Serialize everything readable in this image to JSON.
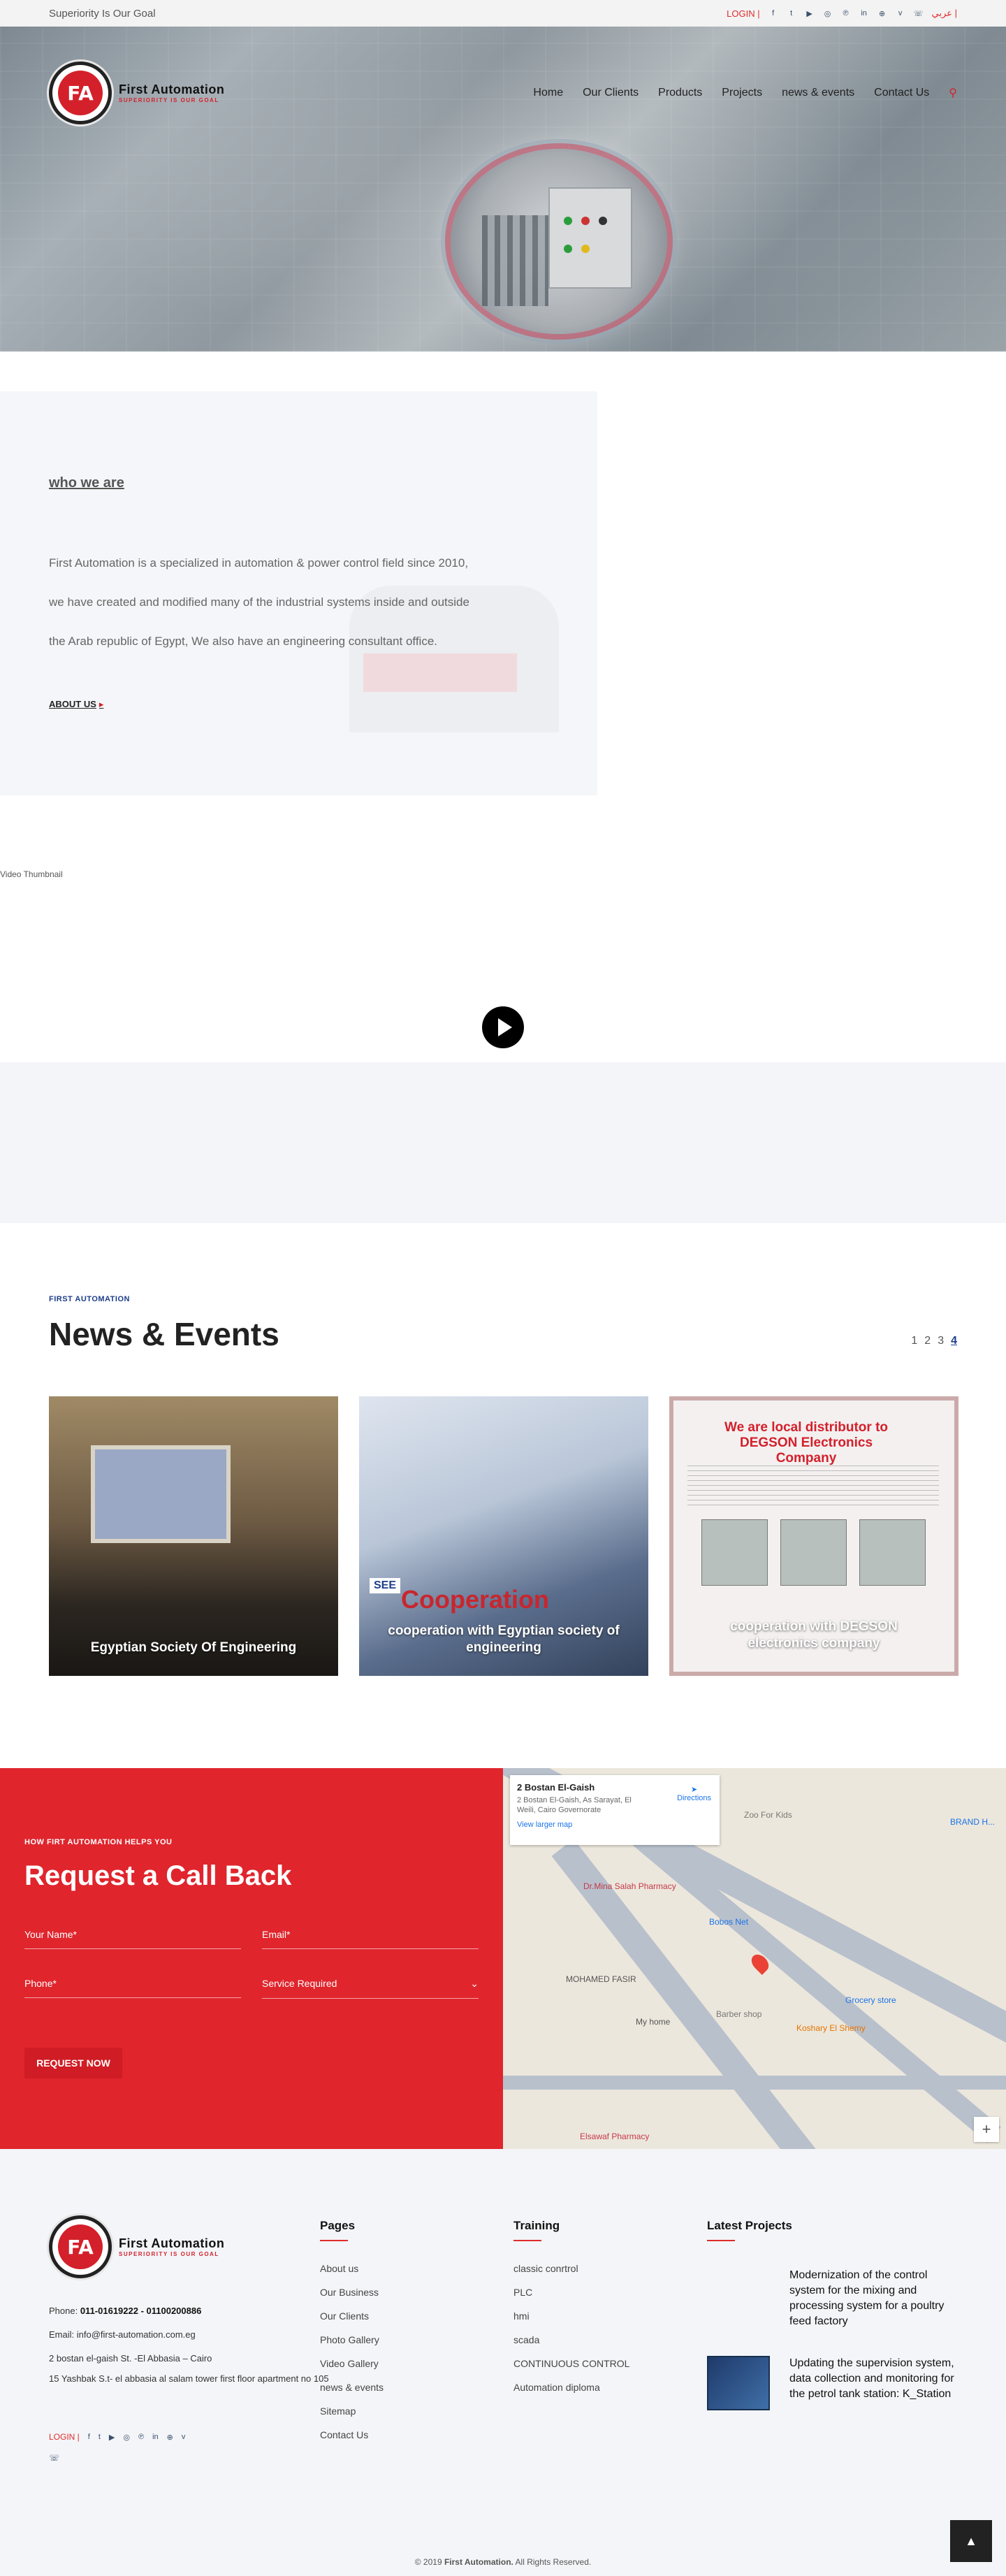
{
  "topbar": {
    "tagline": "Superiority Is Our Goal",
    "login": "LOGIN |",
    "language": "عربي |",
    "social_icons": [
      "facebook-icon",
      "twitter-icon",
      "youtube-icon",
      "instagram-icon",
      "pinterest-icon",
      "linkedin-icon",
      "pinterest-alt-icon",
      "vimeo-icon",
      "whatsapp-icon"
    ]
  },
  "brand": {
    "name": "First Automation",
    "slogan": "SUPERIORITY IS OUR GOAL",
    "monogram": "FA",
    "accent": "#d4202a",
    "navy": "#1d3e8a"
  },
  "nav": {
    "items": [
      "Home",
      "Our Clients",
      "Products",
      "Projects",
      "news & events",
      "Contact Us"
    ]
  },
  "about": {
    "heading": "who we are",
    "body": "First Automation is a specialized in automation & power control field since 2010, we have created and modified many of the industrial systems inside and outside the Arab republic of Egypt, We also have an engineering consultant office.",
    "link": "ABOUT US",
    "link_arrow": "▸"
  },
  "video": {
    "thumbnail_alt": "Video Thumbnail"
  },
  "news": {
    "kicker": "FIRST AUTOMATION",
    "title": "News & Events",
    "pages": [
      "1",
      "2",
      "3",
      "4"
    ],
    "active_page": "4",
    "cards": [
      {
        "caption": "Egyptian Society Of Engineering"
      },
      {
        "caption": "cooperation with Egyptian society of engineering",
        "image_text": "Cooperation",
        "image_badge": "SEE"
      },
      {
        "caption": "cooperation with DEGSON electronics company",
        "image_heading": "We are local distributor to DEGSON Electronics Company"
      }
    ]
  },
  "callback": {
    "kicker": "HOW FIRT AUTOMATION HELPS YOU",
    "title": "Request a Call Back",
    "name_placeholder": "Your Name*",
    "email_placeholder": "Email*",
    "phone_placeholder": "Phone*",
    "service_placeholder": "Service Required",
    "button": "REQUEST NOW"
  },
  "map": {
    "place_title": "2 Bostan El-Gaish",
    "address": "2 Bostan El-Gaish, As Sarayat, El Weili, Cairo Governorate",
    "larger_map": "View larger map",
    "directions": "Directions",
    "labels": [
      "Zoo For Kids",
      "Dr.Mina Salah Pharmacy",
      "Bobos Net",
      "MOHAMED FASIR",
      "My home",
      "Koshary El Shemy",
      "Barber shop",
      "Grocery store",
      "Elsawaf Pharmacy",
      "BRAND H..."
    ],
    "zoom_in": "+"
  },
  "footer": {
    "phone_label": "Phone:",
    "phone": "011-01619222 - 01100200886",
    "email_label": "Email:",
    "email": "info@first-automation.com.eg",
    "address1": "2 bostan el-gaish St. -El Abbasia – Cairo",
    "address2": "15 Yashbak S.t- el abbasia al salam tower first floor apartment no 105",
    "login": "LOGIN |",
    "pages_title": "Pages",
    "pages": [
      "About us",
      "Our Business",
      "Our Clients",
      "Photo Gallery",
      "Video Gallery",
      "news & events",
      "Sitemap",
      "Contact Us"
    ],
    "training_title": "Training",
    "training": [
      "classic conrtrol",
      "PLC",
      "hmi",
      "scada",
      "CONTINUOUS CONTROL",
      "Automation diploma"
    ],
    "projects_title": "Latest Projects",
    "projects": [
      "Modernization of the control system for the mixing and processing system for a poultry feed factory",
      "Updating the supervision system, data collection and monitoring for the petrol tank station: K_Station"
    ],
    "copyright_prefix": "© 2019",
    "copyright_brand": "First Automation.",
    "copyright_suffix": "All Rights Reserved."
  }
}
